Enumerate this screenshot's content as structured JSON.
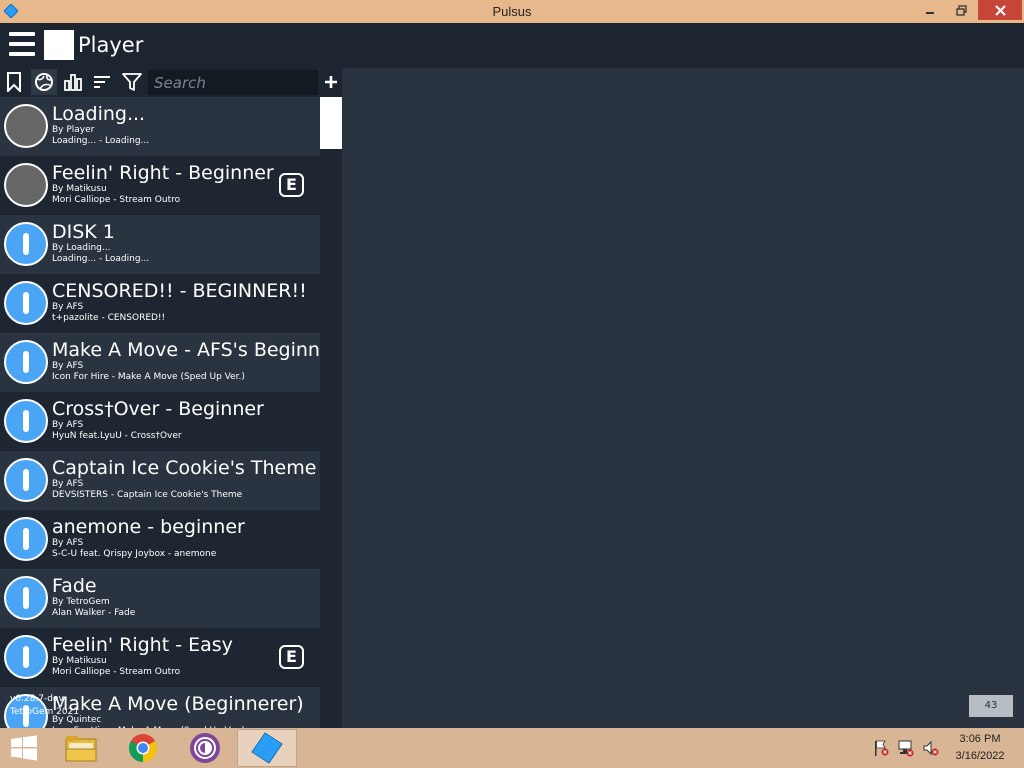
{
  "window": {
    "title": "Pulsus",
    "minimize": "minimize",
    "restore": "restore",
    "close": "close"
  },
  "header": {
    "player_name": "Player"
  },
  "toolbar": {
    "search_placeholder": "Search",
    "add_label": "+",
    "icons": [
      "bookmark-icon",
      "globe-icon",
      "bar-chart-icon",
      "sort-icon",
      "filter-icon"
    ]
  },
  "levels": [
    {
      "title": "Loading...",
      "author": "By Player",
      "song": "Loading... - Loading...",
      "thumb": "gray",
      "badge": ""
    },
    {
      "title": "Feelin' Right - Beginner",
      "author": "By Matikusu",
      "song": "Mori Calliope - Stream Outro",
      "thumb": "gray",
      "badge": "E"
    },
    {
      "title": "DISK 1",
      "author": "By Loading...",
      "song": "Loading... - Loading...",
      "thumb": "blue",
      "badge": ""
    },
    {
      "title": "CENSORED!! - BEGINNER!!",
      "author": "By AFS",
      "song": "t+pazolite - CENSORED!!",
      "thumb": "blue",
      "badge": ""
    },
    {
      "title": "Make A Move - AFS's Beginner",
      "author": "By AFS",
      "song": "Icon For Hire - Make A Move (Sped Up Ver.)",
      "thumb": "blue",
      "badge": ""
    },
    {
      "title": "Cross†Over - Beginner",
      "author": "By AFS",
      "song": "HyuN feat.LyuU - Cross†Over",
      "thumb": "blue",
      "badge": ""
    },
    {
      "title": "Captain Ice Cookie's Theme - Easy",
      "author": "By AFS",
      "song": "DEVSISTERS - Captain Ice Cookie's Theme",
      "thumb": "blue",
      "badge": ""
    },
    {
      "title": "anemone - beginner",
      "author": "By AFS",
      "song": "S-C-U feat. Qrispy Joybox - anemone",
      "thumb": "blue",
      "badge": ""
    },
    {
      "title": "Fade",
      "author": "By TetroGem",
      "song": "Alan Walker - Fade",
      "thumb": "blue",
      "badge": ""
    },
    {
      "title": "Feelin' Right - Easy",
      "author": "By Matikusu",
      "song": "Mori Calliope - Stream Outro",
      "thumb": "blue",
      "badge": "E"
    },
    {
      "title": "Make A Move (Beginnerer)",
      "author": "By Quintec",
      "song": "Icon For Hire - Make A Move (Sped Up Ver.)",
      "thumb": "blue",
      "badge": ""
    }
  ],
  "footer": {
    "version": "v0.28.7-dev",
    "copyright": "TetroGem 2021",
    "count": "43"
  },
  "taskbar": {
    "apps": [
      "start",
      "file-explorer",
      "chrome",
      "tor-browser",
      "pulsus"
    ],
    "time": "3:06 PM",
    "date": "3/16/2022"
  },
  "colors": {
    "titlebar": "#e7b88b",
    "header": "#1c2530",
    "background": "#2a3440",
    "thumb_blue": "#4aa6f5",
    "close": "#c7463a",
    "taskbar": "#d8b595"
  }
}
